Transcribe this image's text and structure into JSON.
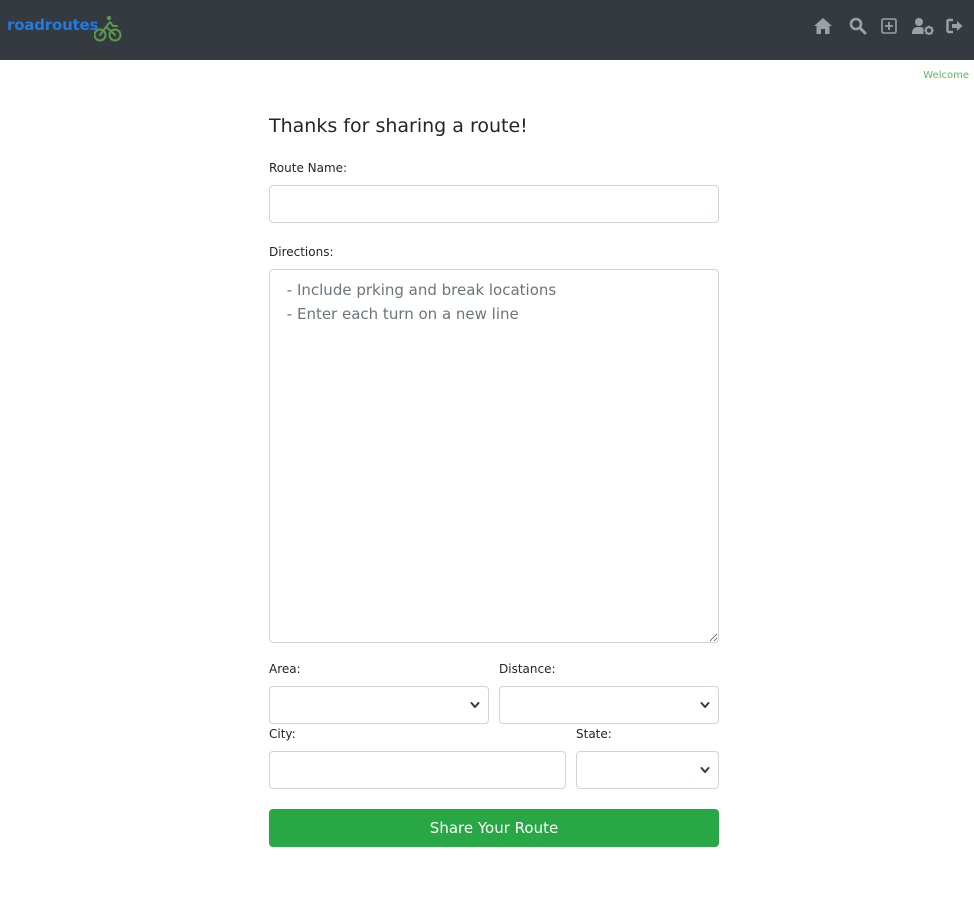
{
  "app": {
    "brand": "roadroutes",
    "brand_color": "#1e7be0",
    "brand_icon": "cyclist-icon",
    "navbar_color": "#343a40"
  },
  "nav": {
    "icons": [
      "home-icon",
      "search-icon",
      "add-square-icon",
      "user-settings-icon",
      "logout-icon"
    ]
  },
  "welcome": "Welcome",
  "form": {
    "title": "Thanks for sharing a route!",
    "route_name": {
      "label": "Route Name:",
      "value": "",
      "placeholder": ""
    },
    "directions": {
      "label": "Directions:",
      "value": "",
      "placeholder": " - Include prking and break locations\n - Enter each turn on a new line"
    },
    "area": {
      "label": "Area:",
      "selected": ""
    },
    "distance": {
      "label": "Distance:",
      "selected": ""
    },
    "city": {
      "label": "City:",
      "value": "",
      "placeholder": ""
    },
    "state": {
      "label": "State:",
      "selected": ""
    },
    "submit_label": "Share Your Route",
    "submit_color": "#28a745"
  }
}
